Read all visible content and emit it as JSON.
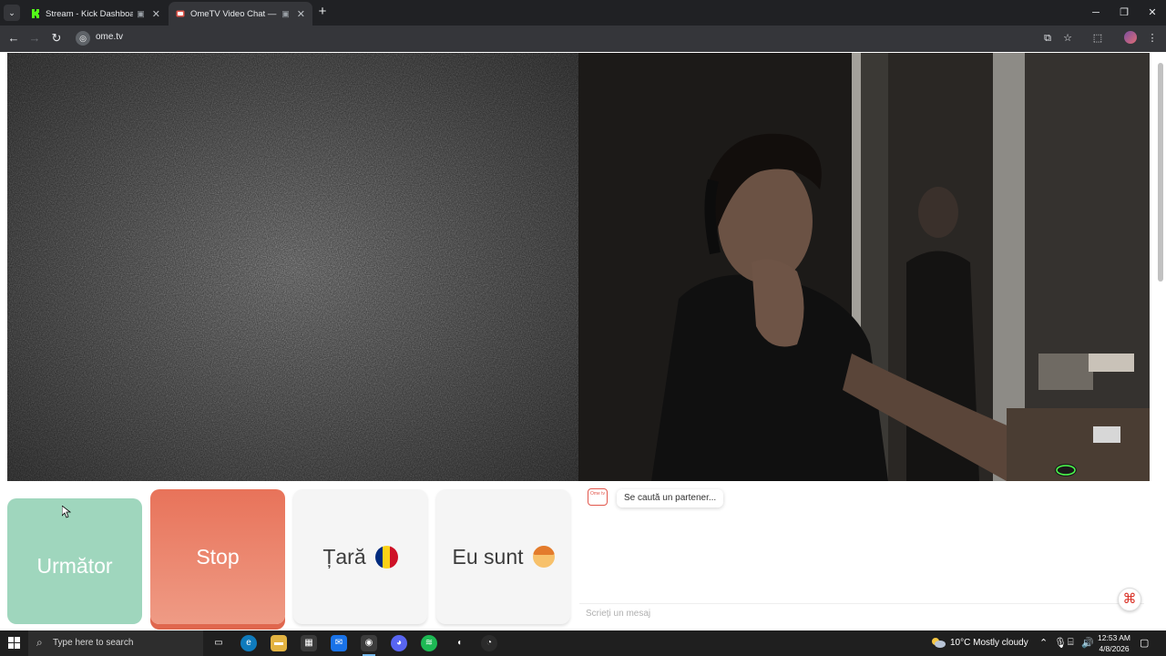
{
  "browser": {
    "tabs": [
      {
        "title": "Stream - Kick Dashboard",
        "favicon": "kick-icon",
        "active": false
      },
      {
        "title": "OmeTV Video Chat — Om",
        "favicon": "ometv-icon",
        "active": true
      }
    ],
    "url": "ome.tv"
  },
  "controls": {
    "next_label": "Următor",
    "stop_label": "Stop",
    "country_label": "Țară",
    "iam_label": "Eu sunt"
  },
  "chat": {
    "logo_text": "Ome tv",
    "status_message": "Se caută un partener...",
    "input_placeholder": "Scrieți un mesaj"
  },
  "taskbar": {
    "search_placeholder": "Type here to search",
    "weather": "10°C  Mostly cloudy",
    "time": "12:53 AM",
    "date": "4/8/2026"
  },
  "colors": {
    "next_button": "#9fd6bd",
    "stop_button": "#e8735a",
    "accent": "#e2574c",
    "flag": [
      "#002b7f",
      "#fcd116",
      "#ce1126"
    ]
  }
}
